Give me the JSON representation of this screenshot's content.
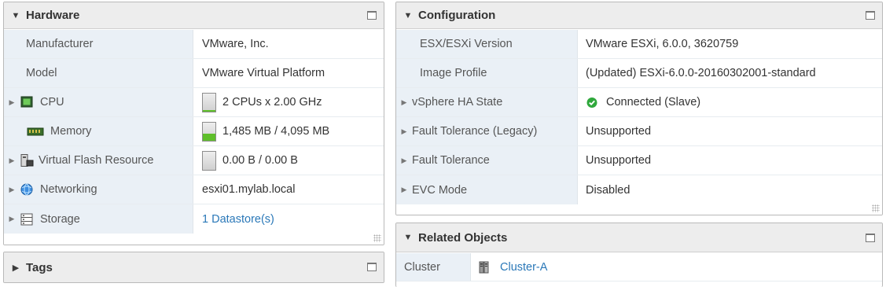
{
  "hardware": {
    "title": "Hardware",
    "manufacturer": {
      "label": "Manufacturer",
      "value": "VMware, Inc."
    },
    "model": {
      "label": "Model",
      "value": "VMware Virtual Platform"
    },
    "cpu": {
      "label": "CPU",
      "value": "2 CPUs x 2.00 GHz",
      "usage_fraction": 0.08,
      "icon": "cpu-icon"
    },
    "memory": {
      "label": "Memory",
      "value": "1,485 MB / 4,095 MB",
      "usage_fraction": 0.36,
      "icon": "memory-icon"
    },
    "flash": {
      "label": "Virtual Flash Resource",
      "value": "0.00 B / 0.00 B",
      "usage_fraction": 0,
      "icon": "flash-icon"
    },
    "networking": {
      "label": "Networking",
      "value": "esxi01.mylab.local",
      "icon": "network-globe-icon"
    },
    "storage": {
      "label": "Storage",
      "value": "1 Datastore(s)",
      "icon": "storage-icon"
    }
  },
  "tags": {
    "title": "Tags"
  },
  "configuration": {
    "title": "Configuration",
    "version": {
      "label": "ESX/ESXi Version",
      "value": "VMware ESXi, 6.0.0, 3620759"
    },
    "image_profile": {
      "label": "Image Profile",
      "value": "(Updated) ESXi-6.0.0-20160302001-standard"
    },
    "ha_state": {
      "label": "vSphere HA State",
      "value": "Connected (Slave)",
      "status_color": "#2fa83c"
    },
    "ft_legacy": {
      "label": "Fault Tolerance (Legacy)",
      "value": "Unsupported"
    },
    "ft": {
      "label": "Fault Tolerance",
      "value": "Unsupported"
    },
    "evc": {
      "label": "EVC Mode",
      "value": "Disabled"
    }
  },
  "related": {
    "title": "Related Objects",
    "cluster": {
      "label": "Cluster",
      "value": "Cluster-A",
      "icon": "cluster-icon"
    }
  },
  "colors": {
    "accent_link": "#2a78b8",
    "label_bg": "#eaf0f6",
    "header_bg": "#ededed",
    "bar_fill": "#5fbf2a"
  }
}
